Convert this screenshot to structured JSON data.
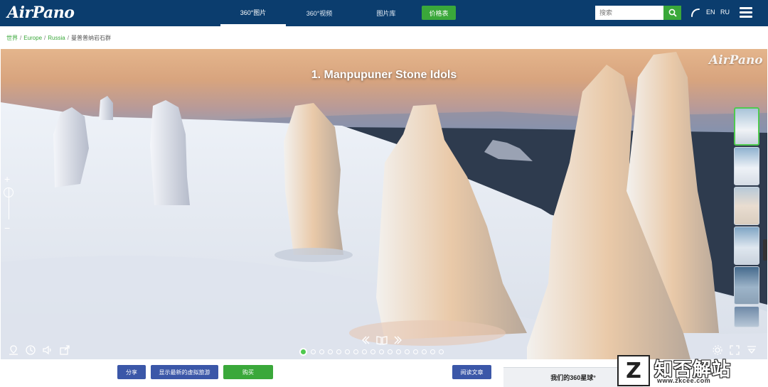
{
  "header": {
    "logo": "AirPano",
    "nav": [
      {
        "label": "360°图片"
      },
      {
        "label": "360°视频"
      },
      {
        "label": "图片库"
      }
    ],
    "price_label": "价格表",
    "search_placeholder": "搜索",
    "lang_en": "EN",
    "lang_ru": "RU",
    "accent_color": "#3aa83a",
    "bar_color": "#0b3d6e"
  },
  "breadcrumb": {
    "items": [
      "世界",
      "Europe",
      "Russia"
    ],
    "current": "曼普普纳岩石群",
    "separator": "/"
  },
  "panorama": {
    "title": "1. Manpupuner Stone Idols",
    "watermark": "AirPano",
    "zoom_plus": "+",
    "zoom_minus": "−",
    "dot_count": 17,
    "active_dot": 0
  },
  "actions": {
    "share": "分享",
    "latest_tour": "显示最新的虚拟旅游",
    "buy": "购买",
    "read_article": "阅读文章",
    "globe_title": "我们的360星球°"
  },
  "site_watermark": {
    "mark": "Z",
    "text": "知否解站",
    "url": "www.zkcee.com"
  }
}
